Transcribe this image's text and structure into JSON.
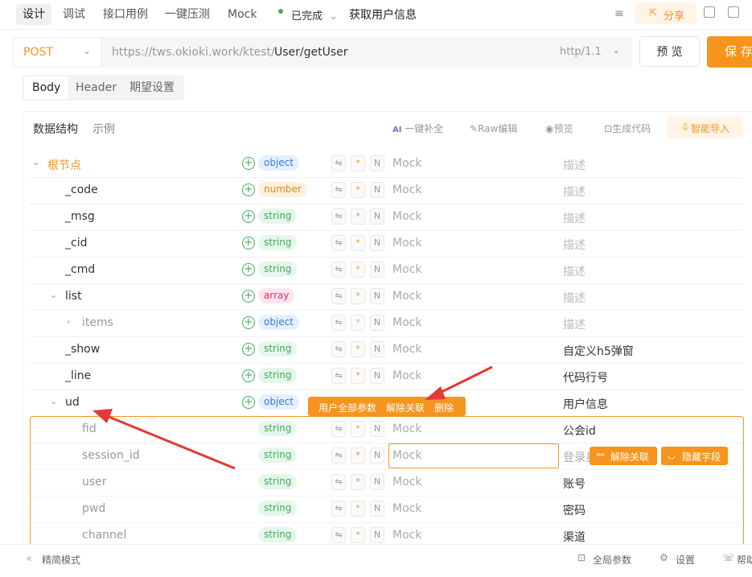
{
  "tabs": [
    "设计",
    "调试",
    "接口用例",
    "一键压测",
    "Mock"
  ],
  "status": {
    "label": "已完成",
    "chevron": "⌄"
  },
  "api_name": "获取用户信息",
  "share_label": "分享",
  "method": "POST",
  "base_url": "https://tws.okioki.work/ktest/",
  "path": "User/getUser",
  "protocol": "http/1.1",
  "preview_btn": "预 览",
  "save_btn": "保 存",
  "subtabs": [
    "Body",
    "Header",
    "期望设置"
  ],
  "panel_tabs": [
    "数据结构",
    "示例"
  ],
  "tools": {
    "ai_complete": "一键补全",
    "raw_edit": "Raw编辑",
    "preview": "预览",
    "gen_code": "生成代码",
    "smart_import": "智能导入"
  },
  "rows": [
    {
      "name": "根节点",
      "type": "object",
      "mock": "Mock",
      "desc": "描述"
    },
    {
      "name": "_code",
      "type": "number",
      "mock": "Mock",
      "desc": "描述"
    },
    {
      "name": "_msg",
      "type": "string",
      "mock": "Mock",
      "desc": "描述"
    },
    {
      "name": "_cid",
      "type": "string",
      "mock": "Mock",
      "desc": "描述"
    },
    {
      "name": "_cmd",
      "type": "string",
      "mock": "Mock",
      "desc": "描述"
    },
    {
      "name": "list",
      "type": "array",
      "mock": "Mock",
      "desc": "描述"
    },
    {
      "name": "items",
      "type": "object",
      "mock": "Mock",
      "desc": "描述"
    },
    {
      "name": "_show",
      "type": "string",
      "mock": "Mock",
      "desc": "自定义h5弹窗"
    },
    {
      "name": "_line",
      "type": "string",
      "mock": "Mock",
      "desc": "代码行号"
    },
    {
      "name": "ud",
      "type": "object",
      "mock": "",
      "desc": "用户信息"
    },
    {
      "name": "fid",
      "type": "string",
      "mock": "Mock",
      "desc": "公会id"
    },
    {
      "name": "session_id",
      "type": "string",
      "mock": "Mock",
      "desc": "登录身"
    },
    {
      "name": "user",
      "type": "string",
      "mock": "Mock",
      "desc": "账号"
    },
    {
      "name": "pwd",
      "type": "string",
      "mock": "Mock",
      "desc": "密码"
    },
    {
      "name": "channel",
      "type": "string",
      "mock": "Mock",
      "desc": "渠道"
    }
  ],
  "ud_actions": {
    "all_params": "用户全部参数",
    "unlink": "解除关联",
    "delete": "删除"
  },
  "row_actions": {
    "unlink": "解除关联",
    "hide_field": "隐藏字段"
  },
  "icons": {
    "settings": "⇋",
    "required": "*",
    "nullable": "N"
  },
  "footer": {
    "simple_mode": "精简模式",
    "global_params": "全局参数",
    "settings": "设置",
    "help": "帮助"
  },
  "colors": {
    "accent": "#f7941d",
    "green": "#3fae5c",
    "blue": "#3a7ad9",
    "red_arrow": "#e53935"
  }
}
